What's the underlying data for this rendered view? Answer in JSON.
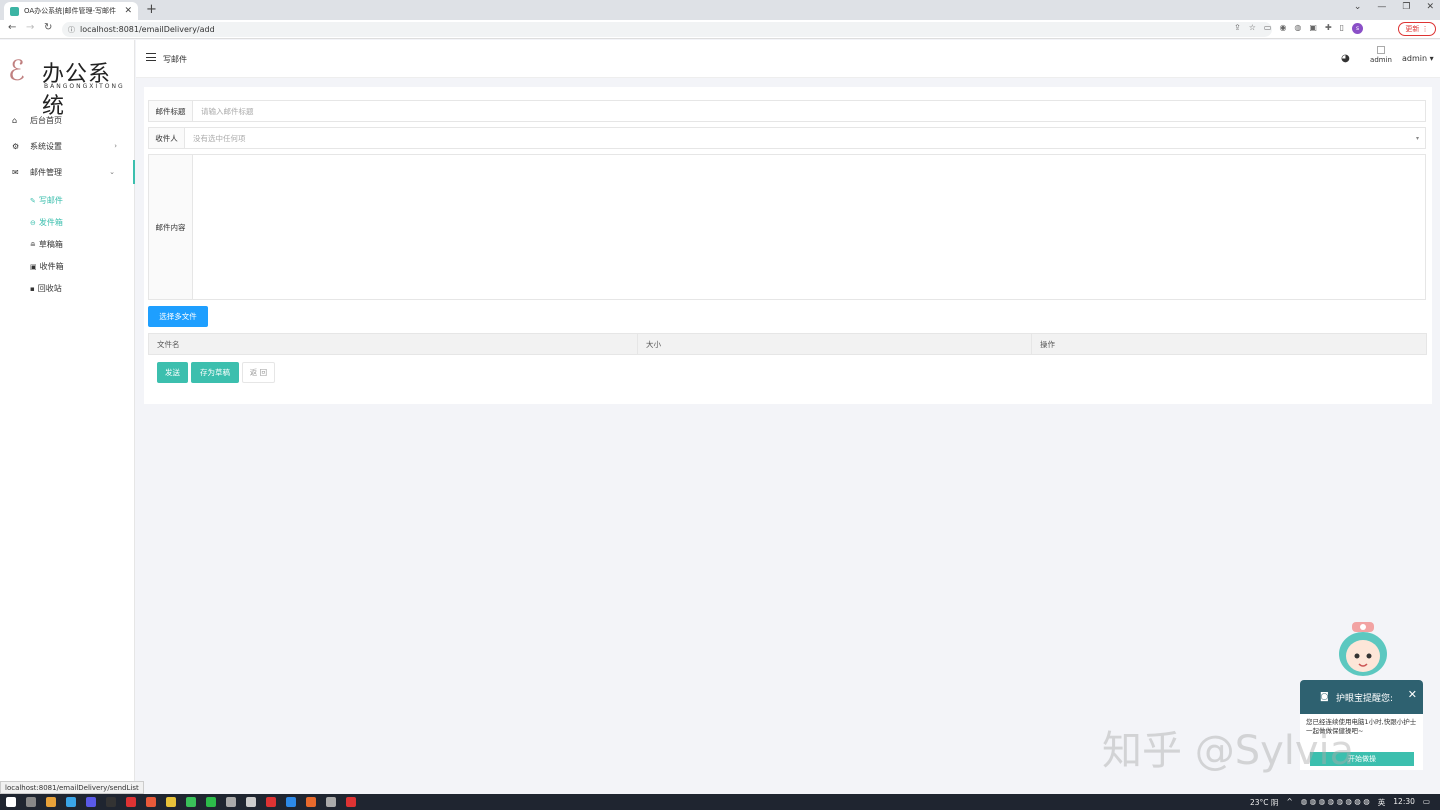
{
  "browser": {
    "tab_title": "OA办公系统|邮件管理-写邮件",
    "url": "localhost:8081/emailDelivery/add",
    "update_label": "更新",
    "profile_initial": "s"
  },
  "sidebar": {
    "logo_title": "办公系统",
    "logo_subtitle": "BANGONGXITONG",
    "items": [
      {
        "label": "后台首页",
        "icon": "home-icon"
      },
      {
        "label": "系统设置",
        "icon": "gear-icon"
      },
      {
        "label": "邮件管理",
        "icon": "mail-icon"
      }
    ],
    "sub_items": [
      {
        "label": "写邮件",
        "icon": "pencil-icon"
      },
      {
        "label": "发件箱",
        "icon": "outbox-icon"
      },
      {
        "label": "草稿箱",
        "icon": "draft-icon"
      },
      {
        "label": "收件箱",
        "icon": "inbox-icon"
      },
      {
        "label": "回收站",
        "icon": "trash-icon"
      }
    ]
  },
  "header": {
    "title": "写邮件",
    "avatar_alt": "admin",
    "user": "admin"
  },
  "form": {
    "subject_label": "邮件标题",
    "subject_placeholder": "请输入邮件标题",
    "recipient_label": "收件人",
    "recipient_value": "没有选中任何项",
    "content_label": "邮件内容",
    "choose_files": "选择多文件",
    "table_headers": [
      "文件名",
      "大小",
      "操作"
    ],
    "send": "发送",
    "save_draft": "存为草稿",
    "back": "返 回"
  },
  "status_url": "localhost:8081/emailDelivery/sendList",
  "popup": {
    "title": "护眼宝提醒您:",
    "message": "您已经连续使用电脑1小时,快跟小护士一起做做保健操吧~",
    "action": "开始做操"
  },
  "watermark": "知乎 @Sylvia",
  "taskbar": {
    "weather": "23°C 阴",
    "time": "12:30",
    "lang": "英"
  },
  "colors": {
    "accent": "#3cbfae",
    "primary_button": "#1e9fff",
    "background": "#f3f4f8"
  }
}
